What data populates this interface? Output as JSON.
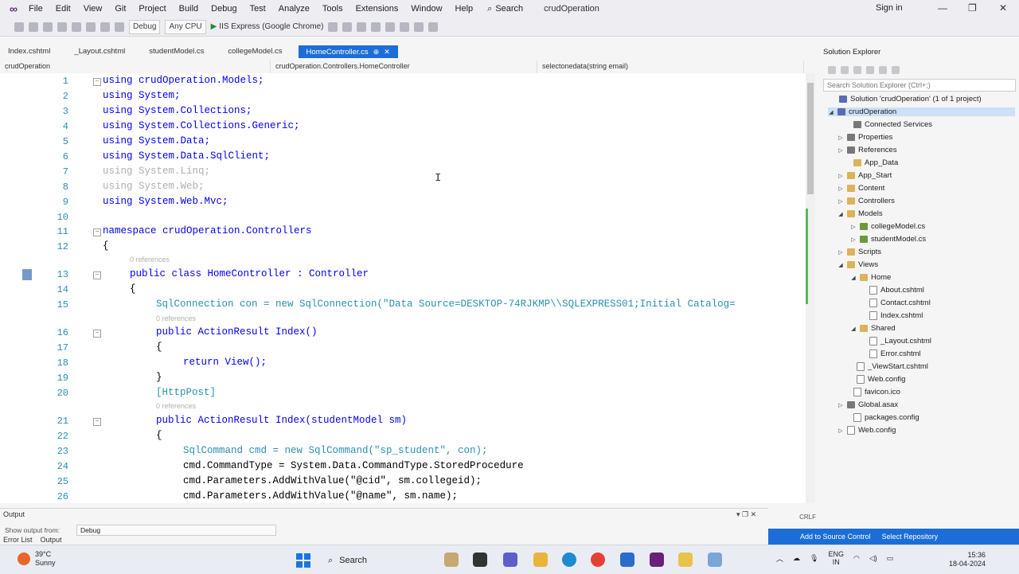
{
  "menu": {
    "items": [
      "File",
      "Edit",
      "View",
      "Git",
      "Project",
      "Build",
      "Debug",
      "Test",
      "Analyze",
      "Tools",
      "Extensions",
      "Window",
      "Help"
    ],
    "search_label": "Search",
    "solution_name": "crudOperation",
    "signin": "Sign in"
  },
  "toolbar": {
    "config": "Debug",
    "platform": "Any CPU",
    "run_label": "IIS Express (Google Chrome)"
  },
  "tabs": [
    {
      "label": "Index.cshtml",
      "active": false
    },
    {
      "label": "_Layout.cshtml",
      "active": false
    },
    {
      "label": "studentModel.cs",
      "active": false
    },
    {
      "label": "collegeModel.cs",
      "active": false
    },
    {
      "label": "HomeController.cs",
      "active": true
    }
  ],
  "navbar": {
    "project": "crudOperation",
    "class": "crudOperation.Controllers.HomeController",
    "member": "selectonedata(string email)"
  },
  "code": {
    "refs": {
      "zero": "0 references"
    },
    "lines": [
      {
        "n": "1",
        "t": "using crudOperation.Models;"
      },
      {
        "n": "2",
        "t": "using System;"
      },
      {
        "n": "3",
        "t": "using System.Collections;"
      },
      {
        "n": "4",
        "t": "using System.Collections.Generic;"
      },
      {
        "n": "5",
        "t": "using System.Data;"
      },
      {
        "n": "6",
        "t": "using System.Data.SqlClient;"
      },
      {
        "n": "7",
        "t": "using System.Linq;"
      },
      {
        "n": "8",
        "t": "using System.Web;"
      },
      {
        "n": "9",
        "t": "using System.Web.Mvc;"
      },
      {
        "n": "10",
        "t": ""
      },
      {
        "n": "11",
        "t": "namespace crudOperation.Controllers"
      },
      {
        "n": "12",
        "t": "{"
      },
      {
        "n": "13",
        "t": "public class HomeController : Controller"
      },
      {
        "n": "14",
        "t": "{"
      },
      {
        "n": "15",
        "t": "SqlConnection con = new SqlConnection(\"Data Source=DESKTOP-74RJKMP\\\\SQLEXPRESS01;Initial Catalog="
      },
      {
        "n": "16",
        "t": "public ActionResult Index()"
      },
      {
        "n": "17",
        "t": "{"
      },
      {
        "n": "18",
        "t": "return View();"
      },
      {
        "n": "19",
        "t": "}"
      },
      {
        "n": "20",
        "t": "[HttpPost]"
      },
      {
        "n": "21",
        "t": "public ActionResult Index(studentModel sm)"
      },
      {
        "n": "22",
        "t": "{"
      },
      {
        "n": "23",
        "t": "SqlCommand cmd = new SqlCommand(\"sp_student\", con);"
      },
      {
        "n": "24",
        "t": "cmd.CommandType = System.Data.CommandType.StoredProcedure"
      },
      {
        "n": "25",
        "t": "cmd.Parameters.AddWithValue(\"@cid\", sm.collegeid);"
      },
      {
        "n": "26",
        "t": "cmd.Parameters.AddWithValue(\"@name\", sm.name);"
      }
    ]
  },
  "solution_explorer": {
    "title": "Solution Explorer",
    "search_placeholder": "Search Solution Explorer (Ctrl+;)",
    "nodes": [
      "Solution 'crudOperation' (1 of 1 project)",
      "crudOperation",
      "Connected Services",
      "Properties",
      "References",
      "App_Data",
      "App_Start",
      "Content",
      "Controllers",
      "Models",
      "collegeModel.cs",
      "studentModel.cs",
      "Scripts",
      "Views",
      "Home",
      "About.cshtml",
      "Contact.cshtml",
      "Index.cshtml",
      "Shared",
      "_Layout.cshtml",
      "Error.cshtml",
      "_ViewStart.cshtml",
      "Web.config",
      "favicon.ico",
      "Global.asax",
      "packages.config",
      "Web.config"
    ]
  },
  "output": {
    "title": "Output",
    "show_label": "Show output from:",
    "source": "Debug",
    "tab_error": "Error List",
    "tab_output": "Output"
  },
  "status": {
    "encoding": "CRLF",
    "source_control": "Add to Source Control",
    "repo": "Select Repository"
  },
  "taskbar": {
    "temp": "39°C",
    "weather": "Sunny",
    "search": "Search",
    "lang1": "ENG",
    "lang2": "IN",
    "time": "15:36",
    "date": "18-04-2024"
  }
}
